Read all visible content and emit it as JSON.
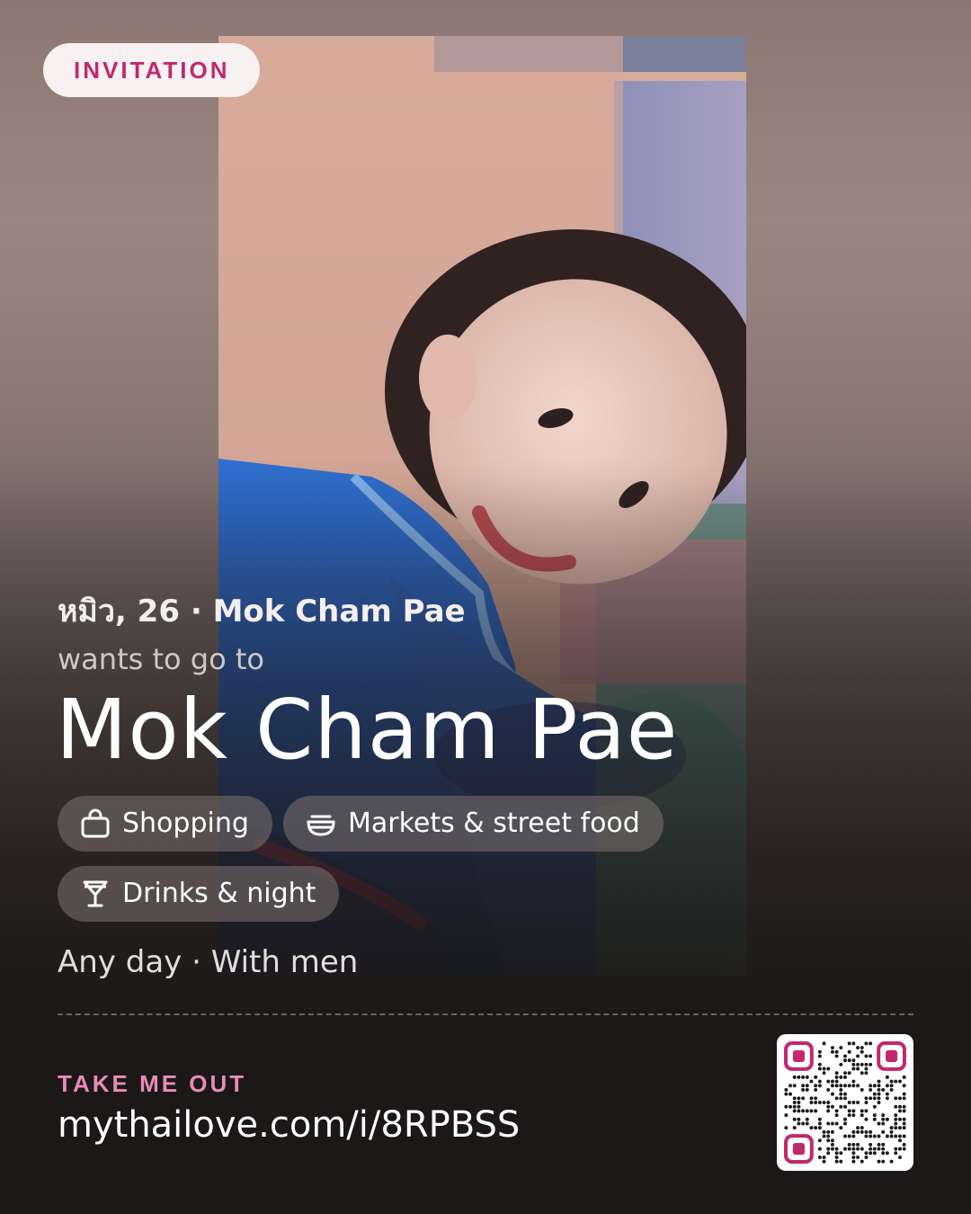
{
  "badge": {
    "label": "INVITATION"
  },
  "profile": {
    "subline": "หมิว, 26 · Mok Cham Pae",
    "intro": "wants to go to",
    "destination": "Mok Cham Pae",
    "photo_alt": "profile photo"
  },
  "tags": [
    {
      "label": "Shopping",
      "icon": "shopping-bag-icon"
    },
    {
      "label": "Markets & street food",
      "icon": "bowl-icon"
    },
    {
      "label": "Drinks & night",
      "icon": "cocktail-glass-icon"
    }
  ],
  "meta": "Any day · With men",
  "cta": {
    "label": "TAKE ME OUT",
    "url": "mythailove.com/i/8RPBSS"
  },
  "colors": {
    "accent": "#c2286e",
    "accent_light": "#e98ab8",
    "qr_finder": "#c2286e"
  }
}
